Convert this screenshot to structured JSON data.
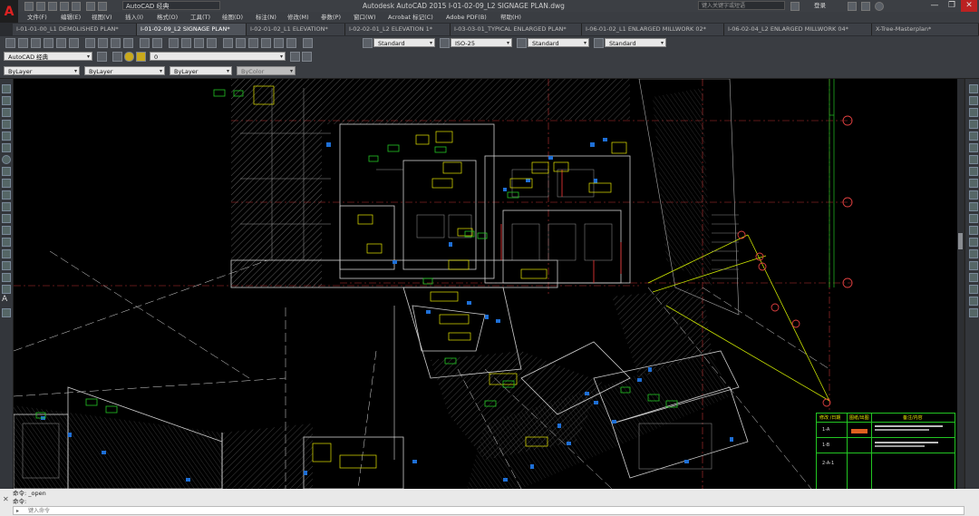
{
  "title_bar": {
    "workspace": "AutoCAD 经典",
    "window_title": "Autodesk AutoCAD 2015    I-01-02-09_L2 SIGNAGE PLAN.dwg",
    "search_placeholder": "键入关键字或短语",
    "user": "登录",
    "minimize": "—",
    "restore": "❐",
    "close": "✕"
  },
  "menu": [
    "文件(F)",
    "编辑(E)",
    "视图(V)",
    "插入(I)",
    "格式(O)",
    "工具(T)",
    "绘图(D)",
    "标注(N)",
    "修改(M)",
    "参数(P)",
    "窗口(W)",
    "Acrobat 标记(C)",
    "Adobe PDF(B)",
    "帮助(H)"
  ],
  "tabs": [
    {
      "label": "I-01-01-00_L1 DEMOLISHED PLAN*",
      "active": false
    },
    {
      "label": "I-01-02-09_L2 SIGNAGE PLAN*",
      "active": true
    },
    {
      "label": "I-02-01-02_L1 ELEVATION*",
      "active": false
    },
    {
      "label": "I-02-02-01_L2 ELEVATION 1*",
      "active": false
    },
    {
      "label": "I-03-03-01_TYPICAL ENLARGED PLAN*",
      "active": false
    },
    {
      "label": "I-06-01-02_L1 ENLARGED MILLWORK 02*",
      "active": false
    },
    {
      "label": "I-06-02-04_L2 ENLARGED MILLWORK 04*",
      "active": false
    },
    {
      "label": "X-Tree-Masterplan*",
      "active": false
    }
  ],
  "style_combos": {
    "text_style": "Standard",
    "dim_style": "ISO-25",
    "table_style": "Standard",
    "mleader_style": "Standard"
  },
  "workspace_combo": "AutoCAD 经典",
  "layer_combo": "0",
  "properties": {
    "color": "ByLayer",
    "linetype": "ByLayer",
    "lineweight": "ByLayer",
    "plotstyle": "ByColor"
  },
  "command": {
    "line1": "命令:  _open",
    "line2": "命令:",
    "input_placeholder": "键入命令"
  },
  "title_block": {
    "header_left": "修改 /日期",
    "header_mid": "图纸/出图",
    "header_right": "备注/内容",
    "rows": [
      "1-A",
      "1-B",
      "2-A-1"
    ]
  }
}
